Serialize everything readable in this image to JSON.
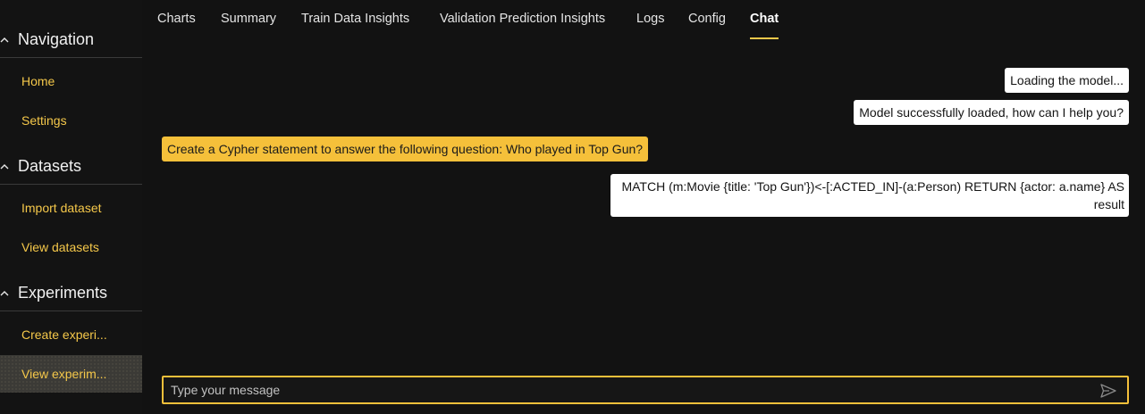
{
  "sidebar": {
    "sections": [
      {
        "title": "Navigation",
        "items": [
          {
            "label": "Home"
          },
          {
            "label": "Settings"
          }
        ]
      },
      {
        "title": "Datasets",
        "items": [
          {
            "label": "Import dataset"
          },
          {
            "label": "View datasets"
          }
        ]
      },
      {
        "title": "Experiments",
        "items": [
          {
            "label": "Create experi..."
          },
          {
            "label": "View experim..."
          }
        ]
      }
    ],
    "active_item": "View experim..."
  },
  "tabs": [
    {
      "label": "Charts"
    },
    {
      "label": "Summary"
    },
    {
      "label": "Train Data Insights"
    },
    {
      "label": "Validation Prediction Insights"
    },
    {
      "label": "Logs"
    },
    {
      "label": "Config"
    },
    {
      "label": "Chat"
    }
  ],
  "active_tab": "Chat",
  "chat": {
    "messages": [
      {
        "role": "bot",
        "text": "Loading the model..."
      },
      {
        "role": "bot",
        "text": "Model successfully loaded, how can I help you?"
      },
      {
        "role": "user",
        "text": "Create a Cypher statement to answer the following question: Who played in Top Gun?"
      },
      {
        "role": "bot",
        "text": "MATCH (m:Movie {title: 'Top Gun'})<-[:ACTED_IN]-(a:Person) RETURN {actor: a.name} AS result"
      }
    ],
    "input": {
      "value": "",
      "placeholder": "Type your message"
    }
  },
  "colors": {
    "accent": "#f5c03a",
    "background": "#121212",
    "nav_text": "#f5c84a"
  },
  "icons": {
    "section_toggle": "chevron-up-icon",
    "send": "send-icon"
  }
}
